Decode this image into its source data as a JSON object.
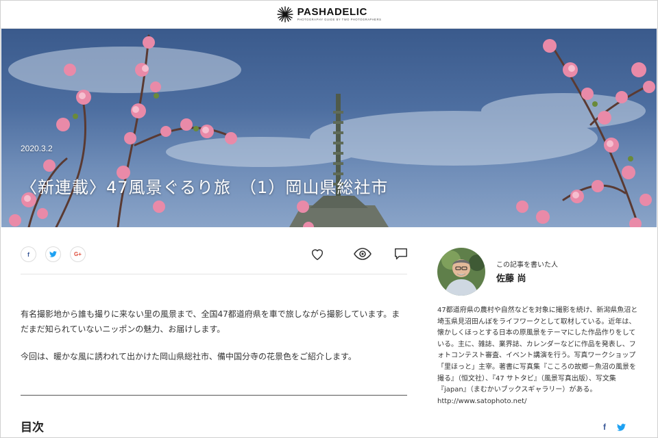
{
  "site": {
    "logo_name": "PASHADELIC",
    "logo_tagline": "PHOTOGRAPHY GUIDE BY TWO PHOTOGRAPHERS",
    "logo_icon": "starburst-icon"
  },
  "hero": {
    "date": "2020.3.2",
    "title": "〈新連載〉47風景ぐるり旅　（1）岡山県総社市"
  },
  "share": {
    "buttons": [
      {
        "icon": "facebook-icon",
        "glyph": "f",
        "color": "#3b5998"
      },
      {
        "icon": "twitter-icon",
        "glyph": "t",
        "color": "#1da1f2"
      },
      {
        "icon": "google-plus-icon",
        "glyph": "G+",
        "color": "#dd4b39"
      }
    ],
    "actions": [
      "heart-icon",
      "eye-icon",
      "comment-icon"
    ]
  },
  "article": {
    "paragraph_1": "有名撮影地から誰も撮りに来ない里の風景まで、全国47都道府県を車で旅しながら撮影しています。まだまだ知られていないニッポンの魅力、お届けします。",
    "paragraph_2": "今回は、暖かな風に誘われて出かけた岡山県総社市、備中国分寺の花景色をご紹介します。",
    "toc_heading": "目次"
  },
  "author": {
    "caption": "この記事を書いた人",
    "name": "佐藤 尚",
    "bio": "47都道府県の農村や自然などを対象に撮影を続け、新潟県魚沼と埼玉県見沼田んぼをライフワークとして取材している。近年は、懐かしくほっとする日本の原風景をテーマにした作品作りをしている。主に、雑誌、業界誌、カレンダーなどに作品を発表し、フォトコンテスト審査、イベント講演を行う。写真ワークショップ「里ほっと」主宰。著書に写真集『こころの故郷－魚沼の風景を撮る』（恒文社）、『47 サトタビ』（風景写真出版）、写文集『japan』（まむかいブックスギャラリー）がある。",
    "url": "http://www.satophoto.net/",
    "social": [
      {
        "icon": "facebook-icon",
        "glyph": "f",
        "color": "#3b5998"
      },
      {
        "icon": "twitter-icon",
        "glyph": "t",
        "color": "#1da1f2"
      }
    ]
  },
  "colors": {
    "sky": "#4d6ea0",
    "blossom": "#e98aa8",
    "pagoda": "#4f5a4a"
  }
}
